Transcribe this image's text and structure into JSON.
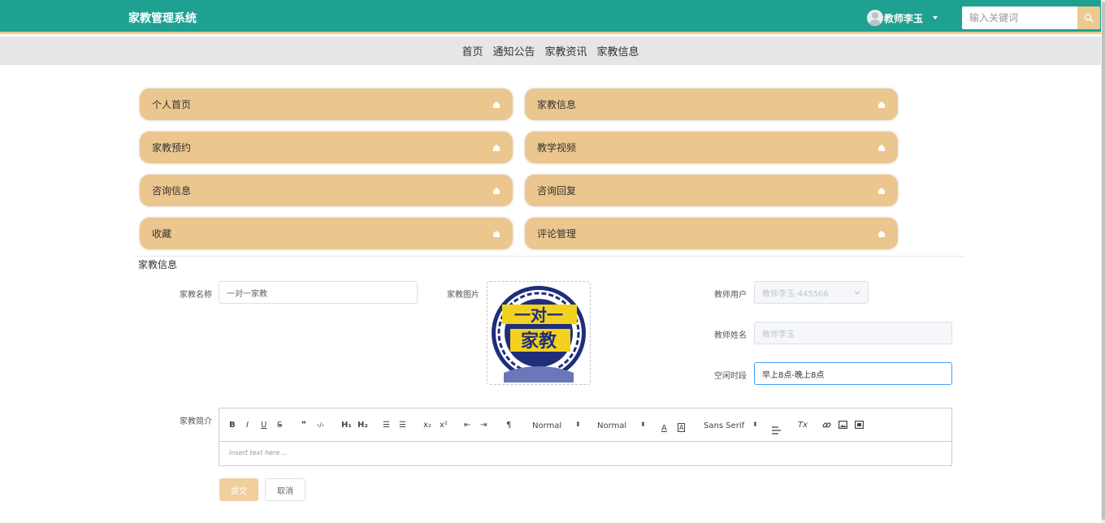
{
  "header": {
    "brand": "家教管理系统",
    "user_name": "教师李玉",
    "search_placeholder": "输入关键词"
  },
  "subnav": [
    "首页",
    "通知公告",
    "家教资讯",
    "家教信息"
  ],
  "tiles": [
    "个人首页",
    "家教信息",
    "家教预约",
    "教学视频",
    "咨询信息",
    "咨询回复",
    "收藏",
    "评论管理"
  ],
  "form": {
    "section_title": "家教信息",
    "name_label": "家教名称",
    "name_value": "一对一家教",
    "image_label": "家教图片",
    "image_text_top": "一对一",
    "image_text_bottom": "家教",
    "teacher_user_label": "教师用户",
    "teacher_user_value": "教师李玉-445566",
    "teacher_name_label": "教师姓名",
    "teacher_name_value": "教师李玉",
    "free_time_label": "空闲时段",
    "free_time_value": "早上8点-晚上8点",
    "intro_label": "家教简介",
    "editor_placeholder": "Insert text here ...",
    "toolbar": {
      "bold": "B",
      "italic": "I",
      "underline": "U",
      "strike": "S",
      "quote": "❞",
      "code": "‹/›",
      "h1": "H₁",
      "h2": "H₂",
      "ol": "☰",
      "ul": "☰",
      "sub": "x₂",
      "sup": "x²",
      "outdent": "⇤",
      "indent": "⇥",
      "rtl": "¶",
      "size_value": "Normal",
      "header_value": "Normal",
      "font_value": "Sans Serif",
      "color": "A",
      "background": "A",
      "clean": "Tx"
    },
    "submit_label": "提交",
    "cancel_label": "取消"
  },
  "colors": {
    "topbar": "#1fa191",
    "accent": "#ecc98f",
    "tile": "#ecc68f",
    "subnav": "#e6e6e6"
  }
}
